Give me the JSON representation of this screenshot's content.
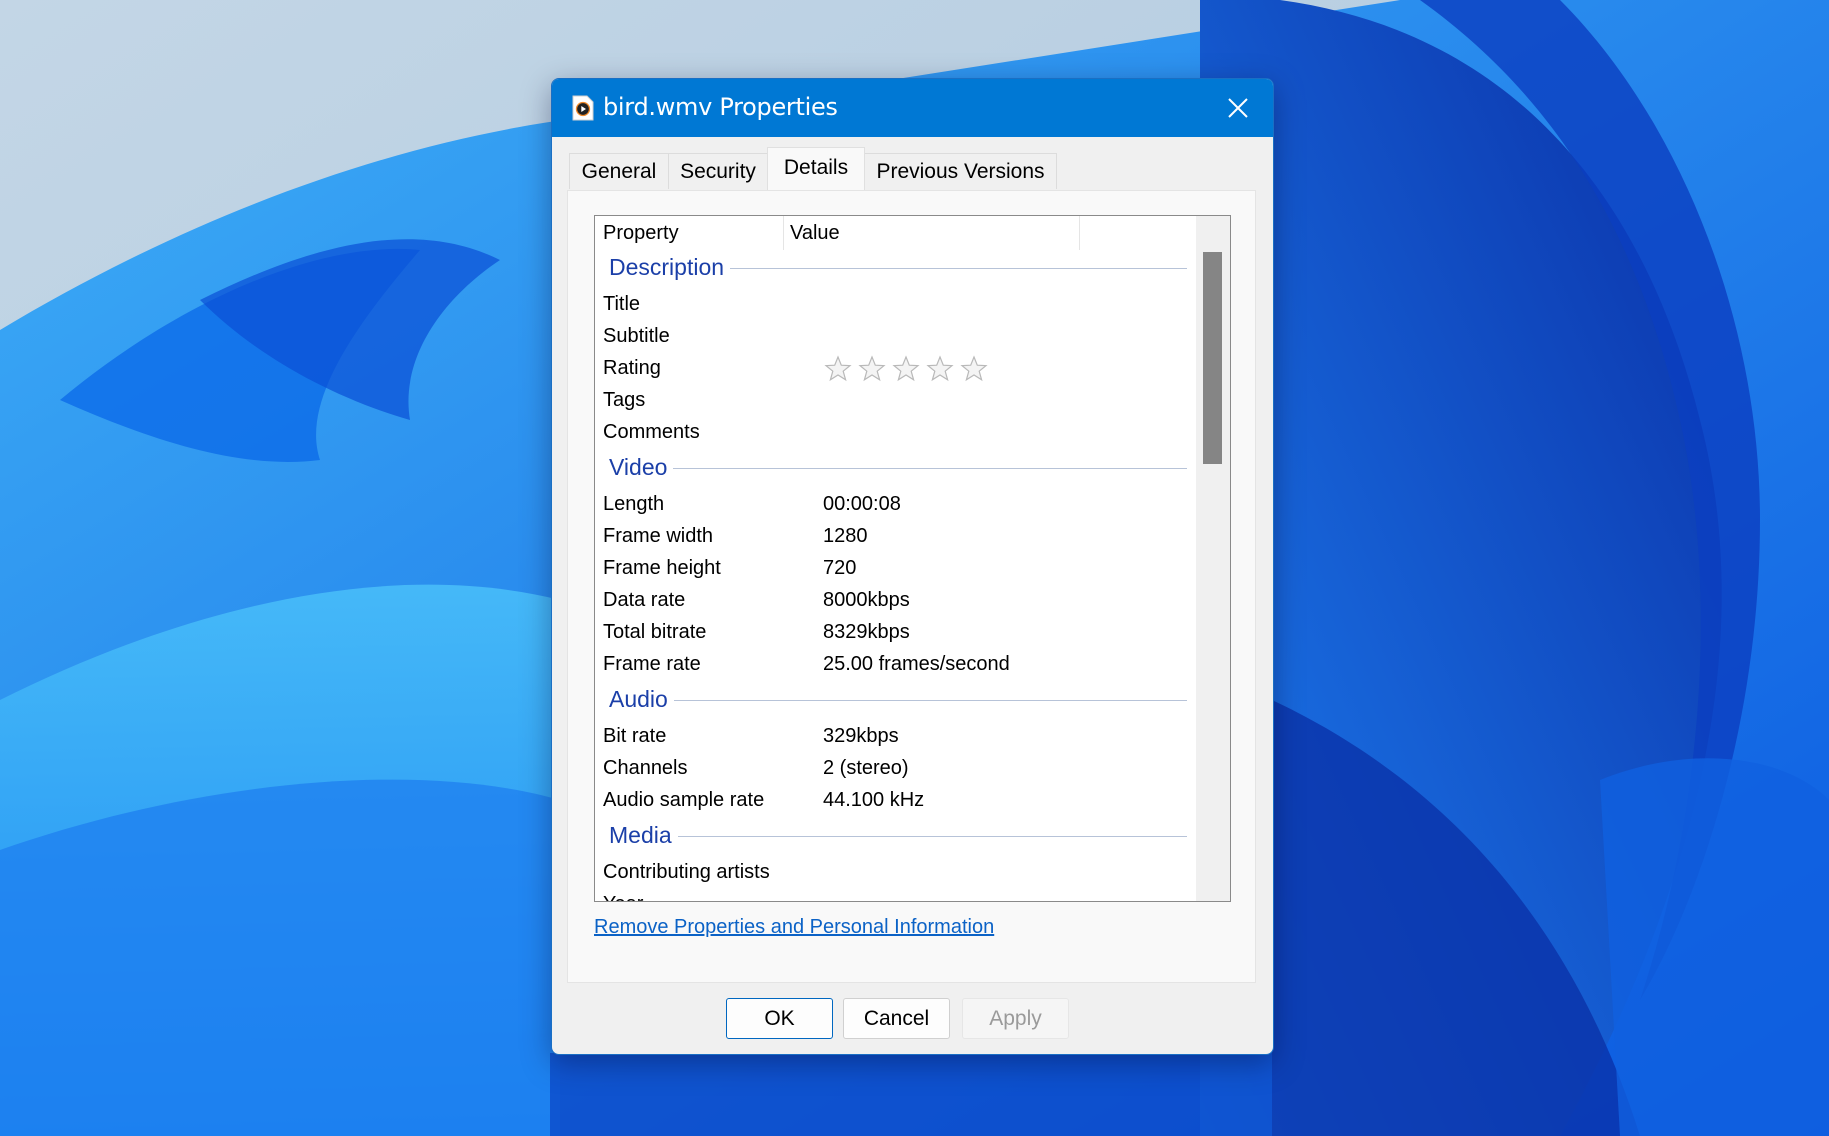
{
  "dialog": {
    "title": "bird.wmv Properties",
    "title_icon": "media-file-icon",
    "close_icon": "close-icon"
  },
  "tabs": [
    {
      "label": "General",
      "active": false
    },
    {
      "label": "Security",
      "active": false
    },
    {
      "label": "Details",
      "active": true
    },
    {
      "label": "Previous Versions",
      "active": false
    }
  ],
  "details": {
    "columns": {
      "property": "Property",
      "value": "Value"
    },
    "groups": [
      {
        "heading": "Description",
        "rows": [
          {
            "label": "Title",
            "value": ""
          },
          {
            "label": "Subtitle",
            "value": ""
          },
          {
            "label": "Rating",
            "value": "",
            "rating": {
              "stars": 0,
              "max": 5
            }
          },
          {
            "label": "Tags",
            "value": ""
          },
          {
            "label": "Comments",
            "value": ""
          }
        ]
      },
      {
        "heading": "Video",
        "rows": [
          {
            "label": "Length",
            "value": "00:00:08"
          },
          {
            "label": "Frame width",
            "value": "1280"
          },
          {
            "label": "Frame height",
            "value": "720"
          },
          {
            "label": "Data rate",
            "value": "8000kbps"
          },
          {
            "label": "Total bitrate",
            "value": "8329kbps"
          },
          {
            "label": "Frame rate",
            "value": "25.00 frames/second"
          }
        ]
      },
      {
        "heading": "Audio",
        "rows": [
          {
            "label": "Bit rate",
            "value": "329kbps"
          },
          {
            "label": "Channels",
            "value": "2 (stereo)"
          },
          {
            "label": "Audio sample rate",
            "value": "44.100 kHz"
          }
        ]
      },
      {
        "heading": "Media",
        "rows": [
          {
            "label": "Contributing artists",
            "value": ""
          },
          {
            "label": "Year",
            "value": ""
          }
        ]
      }
    ]
  },
  "link": {
    "label": "Remove Properties and Personal Information"
  },
  "buttons": {
    "ok": "OK",
    "cancel": "Cancel",
    "apply": "Apply"
  },
  "colors": {
    "titlebar": "#0078d4",
    "group_heading": "#1b3fa8",
    "link": "#0b62c6"
  }
}
